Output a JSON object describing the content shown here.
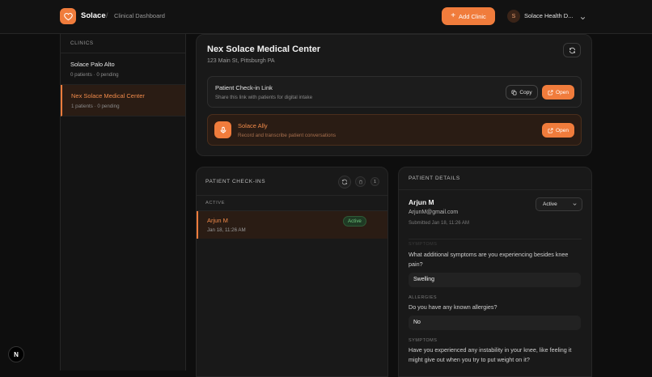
{
  "colors": {
    "accent": "#f07c3c",
    "background": "#0e0e0e",
    "card": "#191919",
    "active_green": "#6cc47c"
  },
  "header": {
    "brand": "Solace",
    "separator": "/",
    "breadcrumb": "Clinical Dashboard",
    "add_clinic_label": "Add Clinic",
    "avatar_initial": "S",
    "org_name": "Solace Health D..."
  },
  "sidebar": {
    "heading": "CLINICS",
    "clinics": [
      {
        "name": "Solace Palo Alto",
        "meta": "0 patients · 0 pending"
      },
      {
        "name": "Nex Solace Medical Center",
        "meta": "1 patients · 0 pending"
      }
    ]
  },
  "clinic_card": {
    "name": "Nex Solace Medical Center",
    "address": "123 Main St, Pittsburgh PA",
    "checkin_link": {
      "title": "Patient Check-in Link",
      "subtitle": "Share this link with patients for digital intake",
      "copy_label": "Copy",
      "open_label": "Open"
    },
    "ally": {
      "title": "Solace Ally",
      "subtitle": "Record and transcribe patient conversations",
      "open_label": "Open"
    }
  },
  "checkins": {
    "heading": "PATIENT CHECK-INS",
    "count": "1",
    "section_label": "ACTIVE",
    "items": [
      {
        "name": "Arjun M",
        "time": "Jan 18, 11:26 AM",
        "status": "Active"
      }
    ]
  },
  "details": {
    "heading": "PATIENT DETAILS",
    "name": "Arjun M",
    "email": "ArjunM@gmail.com",
    "submitted": "Submitted Jan 18, 11:26 AM",
    "status_value": "Active",
    "questions": [
      {
        "label": "SYMPTOMS",
        "question": "What additional symptoms are you experiencing besides knee pain?",
        "answer": "Swelling"
      },
      {
        "label": "ALLERGIES",
        "question": "Do you have any known allergies?",
        "answer": "No"
      },
      {
        "label": "SYMPTOMS",
        "question": "Have you experienced any instability in your knee, like feeling it might give out when you try to put weight on it?",
        "answer": ""
      }
    ]
  },
  "dev_badge": "N"
}
